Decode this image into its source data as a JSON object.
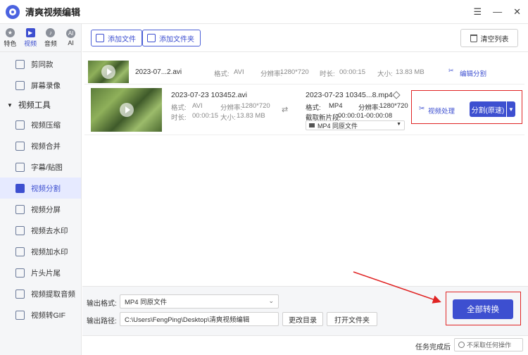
{
  "app": {
    "title": "清爽视频编辑"
  },
  "window_controls": {
    "menu": "☰",
    "minimize": "—",
    "close": "✕"
  },
  "rail_tabs": [
    {
      "label": "特色",
      "glyph": "★"
    },
    {
      "label": "视频",
      "glyph": "▶"
    },
    {
      "label": "音频",
      "glyph": "♪"
    },
    {
      "label": "AI",
      "glyph": "AI"
    }
  ],
  "nav": {
    "top_items": [
      "剪同款",
      "屏幕录像"
    ],
    "section": "视频工具",
    "items": [
      "视频压缩",
      "视频合并",
      "字幕/贴图",
      "视频分割",
      "视频分屏",
      "视频去水印",
      "视频加水印",
      "片头片尾",
      "视频提取音频",
      "视频转GIF"
    ],
    "active": "视频分割"
  },
  "toolbar": {
    "add_file": "添加文件",
    "add_folder": "添加文件夹",
    "clear_list": "清空列表"
  },
  "file1": {
    "name": "2023-07...2.avi",
    "format_label": "格式:",
    "format": "AVI",
    "resolution_label": "分辨率:",
    "resolution": "1280*720",
    "duration_label": "时长:",
    "duration": "00:00:15",
    "size_label": "大小:",
    "size": "13.83 MB",
    "edit_split": "编辑分割"
  },
  "file2": {
    "name": "2023-07-23 103452.avi",
    "format_label": "格式:",
    "format": "AVI",
    "resolution_label": "分辨率:",
    "resolution": "1280*720",
    "duration_label": "时长:",
    "duration": "00:00:15",
    "size_label": "大小:",
    "size": "13.83 MB",
    "output_name": "2023-07-23 10345...8.mp4",
    "out_format_label": "格式:",
    "out_format": "MP4",
    "out_resolution_label": "分辨率:",
    "out_resolution": "1280*720",
    "clip_label": "截取新片段:",
    "clip_range": "00:00:01-00:00:08",
    "format_select": "MP4   同原文件",
    "video_process": "视频处理",
    "split_button": "分割(原速)"
  },
  "output": {
    "format_label": "输出格式:",
    "format_value": "MP4   同原文件",
    "path_label": "输出路径:",
    "path_value": "C:\\Users\\FengPing\\Desktop\\清爽视频编辑",
    "change_dir": "更改目录",
    "open_folder": "打开文件夹",
    "convert_all": "全部转换"
  },
  "status": {
    "after_done_label": "任务完成后",
    "after_done_value": "不采取任何操作"
  },
  "colors": {
    "accent": "#3d4fd0",
    "annotation_red": "#e02424"
  }
}
